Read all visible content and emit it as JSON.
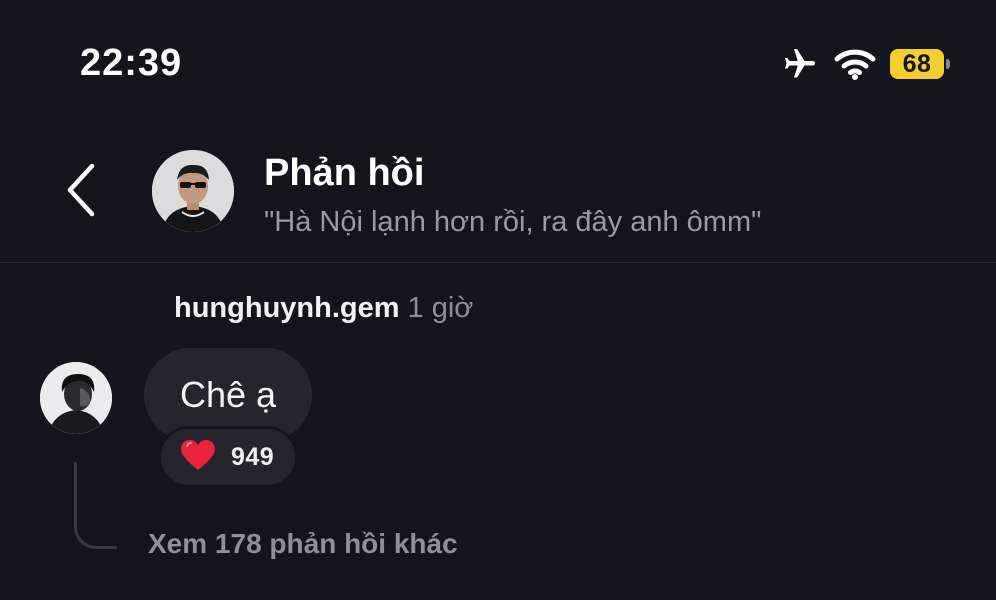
{
  "status_bar": {
    "time": "22:39",
    "battery_level": "68",
    "icons": [
      "airplane-mode-icon",
      "wifi-icon",
      "battery-icon"
    ]
  },
  "header": {
    "back_icon": "chevron-left-icon",
    "title": "Phản hồi",
    "subtitle": "\"Hà Nội lạnh hơn rồi, ra đây anh ômm\""
  },
  "comment": {
    "username": "hunghuynh.gem",
    "time_ago": "1 giờ",
    "text": "Chê ạ",
    "reaction_icon": "heart-icon",
    "reaction_count": "949",
    "more_replies_label": "Xem 178 phản hồi khác"
  },
  "colors": {
    "background": "#15141c",
    "bubble": "#26252e",
    "battery": "#f5cf2f",
    "heart": "#e8233b",
    "muted_text": "#9a9aa3"
  }
}
